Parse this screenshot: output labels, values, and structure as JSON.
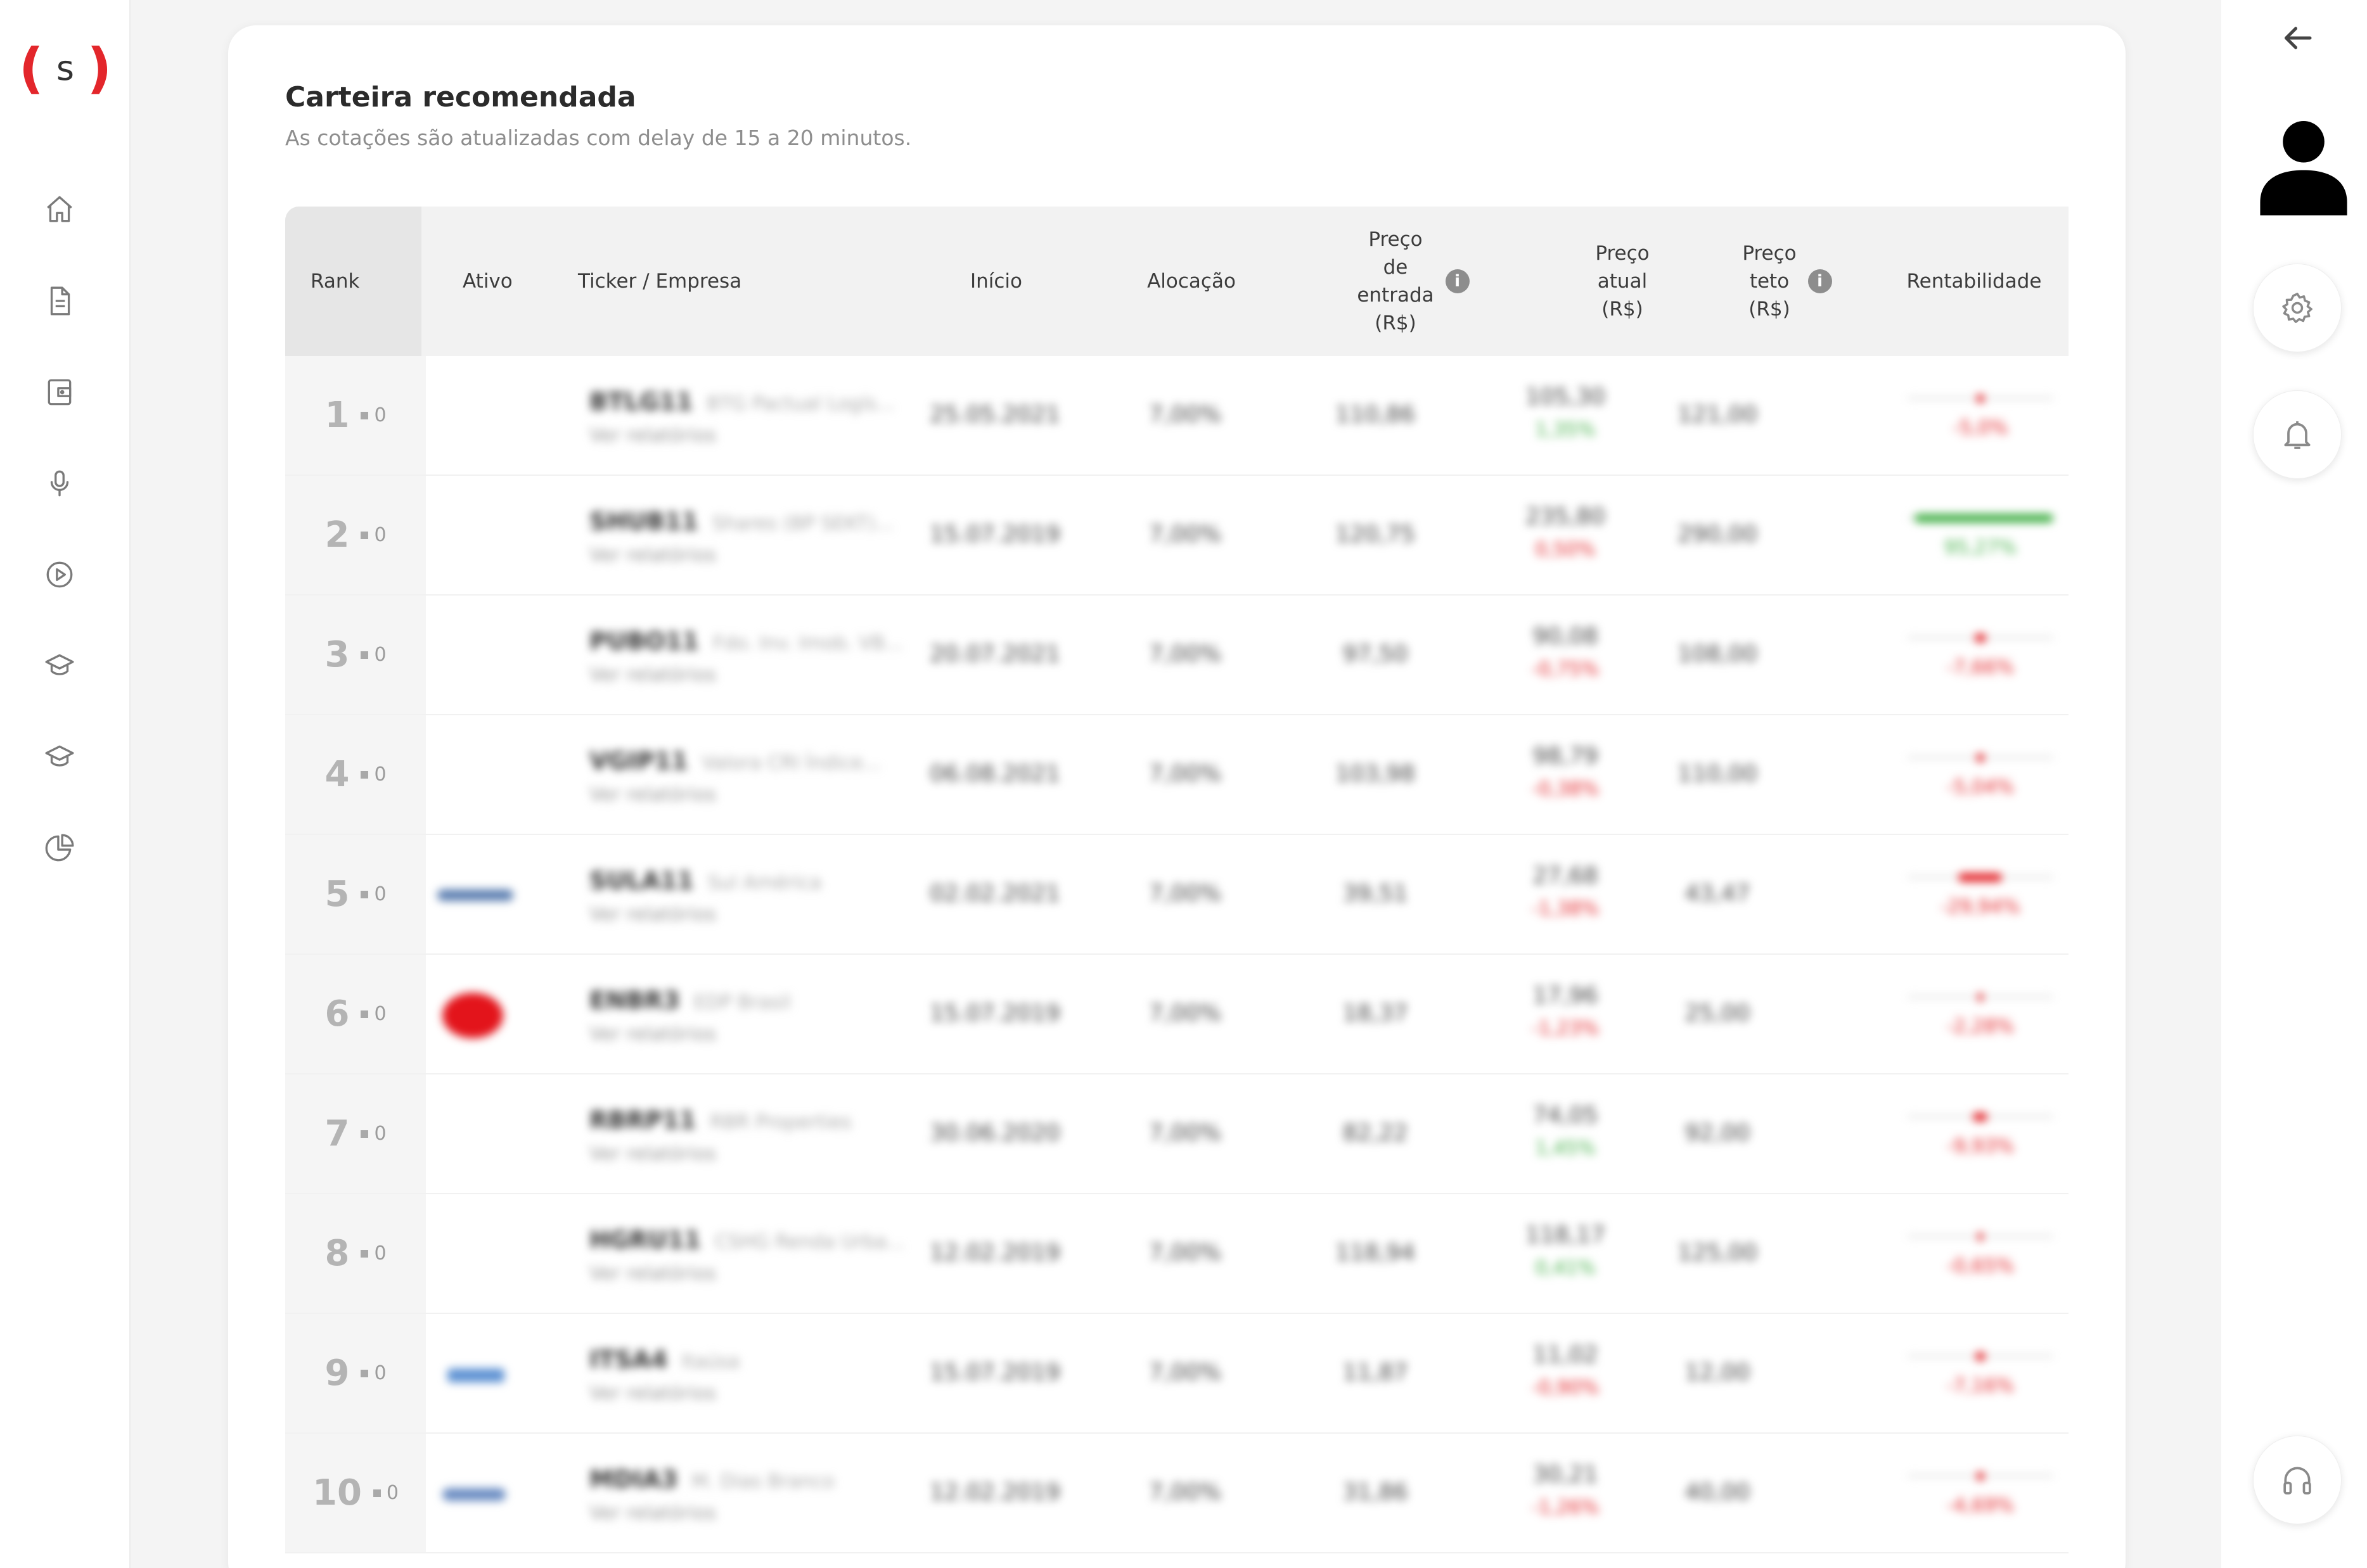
{
  "brand": {
    "logo_left": "(",
    "logo_letter": "s",
    "logo_right": ")",
    "accent_color": "#e3262b"
  },
  "left_nav": [
    {
      "name": "home-icon"
    },
    {
      "name": "document-icon"
    },
    {
      "name": "wallet-icon"
    },
    {
      "name": "microphone-icon"
    },
    {
      "name": "play-circle-icon"
    },
    {
      "name": "graduation-cap-icon"
    },
    {
      "name": "graduation-cap-icon-2"
    },
    {
      "name": "pie-chart-icon"
    }
  ],
  "right_panel": {
    "icons": [
      "back-arrow-icon",
      "user-avatar-icon",
      "gear-icon",
      "bell-icon",
      "headphones-icon"
    ]
  },
  "page": {
    "title": "Carteira recomendada",
    "subtitle": "As cotações são atualizadas com delay de 15 a 20 minutos."
  },
  "table": {
    "headers": {
      "rank": "Rank",
      "ativo": "Ativo",
      "ticker": "Ticker / Empresa",
      "inicio": "Início",
      "alocacao": "Alocação",
      "preco_entrada_1": "Preço",
      "preco_entrada_2": "de",
      "preco_entrada_3": "entrada",
      "preco_entrada_4": "(R$)",
      "preco_atual_1": "Preço",
      "preco_atual_2": "atual",
      "preco_atual_3": "(R$)",
      "preco_teto_1": "Preço",
      "preco_teto_2": "teto",
      "preco_teto_3": "(R$)",
      "rentabilidade": "Rentabilidade",
      "info_glyph": "i"
    },
    "rows": [
      {
        "rank": "1",
        "change": "0",
        "ticker": "BTLG11",
        "company": "BTG Pactual Logís...",
        "sub": "Ver relatórios",
        "inicio": "25.05.2021",
        "alocacao": "7,00%",
        "entrada": "110,86",
        "atual": "105,30",
        "atual_pct": "1,35%",
        "atual_pos": true,
        "teto": "121,00",
        "rent": "-5,0%",
        "rent_pos": false,
        "rent_frac": 0.05,
        "logo": ""
      },
      {
        "rank": "2",
        "change": "0",
        "ticker": "SHUB11",
        "company": "Shares (BP SEKT)...",
        "sub": "Ver relatórios",
        "inicio": "15.07.2019",
        "alocacao": "7,00%",
        "entrada": "120,75",
        "atual": "235,80",
        "atual_pct": "0,50%",
        "atual_pos": false,
        "teto": "290,00",
        "rent": "95,27%",
        "rent_pos": true,
        "rent_frac": 0.95,
        "logo": ""
      },
      {
        "rank": "3",
        "change": "0",
        "ticker": "PUBO11",
        "company": "Fdo. Inv. Imob. VB...",
        "sub": "Ver relatórios",
        "inicio": "20.07.2021",
        "alocacao": "7,00%",
        "entrada": "97,50",
        "atual": "90,08",
        "atual_pct": "-0,75%",
        "atual_pos": false,
        "teto": "108,00",
        "rent": "-7,66%",
        "rent_pos": false,
        "rent_frac": 0.08,
        "logo": ""
      },
      {
        "rank": "4",
        "change": "0",
        "ticker": "VGIP11",
        "company": "Valora CRI Índice...",
        "sub": "Ver relatórios",
        "inicio": "06.08.2021",
        "alocacao": "7,00%",
        "entrada": "103,98",
        "atual": "98,79",
        "atual_pct": "-0,38%",
        "atual_pos": false,
        "teto": "110,00",
        "rent": "-5,04%",
        "rent_pos": false,
        "rent_frac": 0.05,
        "logo": ""
      },
      {
        "rank": "5",
        "change": "0",
        "ticker": "SULA11",
        "company": "Sul América",
        "sub": "Ver relatórios",
        "inicio": "02.02.2021",
        "alocacao": "7,00%",
        "entrada": "39,51",
        "atual": "27,68",
        "atual_pct": "-1,38%",
        "atual_pos": false,
        "teto": "43,47",
        "rent": "-29,94%",
        "rent_pos": false,
        "rent_frac": 0.3,
        "logo": "blue-wave"
      },
      {
        "rank": "6",
        "change": "0",
        "ticker": "ENBR3",
        "company": "EDP Brasil",
        "sub": "Ver relatórios",
        "inicio": "15.07.2019",
        "alocacao": "7,00%",
        "entrada": "18,37",
        "atual": "17,96",
        "atual_pct": "-1,23%",
        "atual_pos": false,
        "teto": "25,00",
        "rent": "-2,28%",
        "rent_pos": false,
        "rent_frac": 0.02,
        "logo": "red-circle"
      },
      {
        "rank": "7",
        "change": "0",
        "ticker": "RBRP11",
        "company": "RBR Properties",
        "sub": "Ver relatórios",
        "inicio": "30.06.2020",
        "alocacao": "7,00%",
        "entrada": "82,22",
        "atual": "74,05",
        "atual_pct": "1,45%",
        "atual_pos": true,
        "teto": "92,00",
        "rent": "-9,93%",
        "rent_pos": false,
        "rent_frac": 0.1,
        "logo": ""
      },
      {
        "rank": "8",
        "change": "0",
        "ticker": "HGRU11",
        "company": "CSHG Renda Urba...",
        "sub": "Ver relatórios",
        "inicio": "12.02.2019",
        "alocacao": "7,00%",
        "entrada": "118,94",
        "atual": "118,17",
        "atual_pct": "0,41%",
        "atual_pos": true,
        "teto": "125,00",
        "rent": "-0,65%",
        "rent_pos": false,
        "rent_frac": 0.01,
        "logo": ""
      },
      {
        "rank": "9",
        "change": "0",
        "ticker": "ITSA4",
        "company": "Itaúsa",
        "sub": "Ver relatórios",
        "inicio": "15.07.2019",
        "alocacao": "7,00%",
        "entrada": "11,87",
        "atual": "11,02",
        "atual_pct": "-0,90%",
        "atual_pos": false,
        "teto": "12,00",
        "rent": "-7,16%",
        "rent_pos": false,
        "rent_frac": 0.07,
        "logo": "blue-text"
      },
      {
        "rank": "10",
        "change": "0",
        "ticker": "MDIA3",
        "company": "M. Dias Branco",
        "sub": "Ver relatórios",
        "inicio": "12.02.2019",
        "alocacao": "7,00%",
        "entrada": "31,86",
        "atual": "30,21",
        "atual_pct": "-1,26%",
        "atual_pos": false,
        "teto": "40,00",
        "rent": "-4,69%",
        "rent_pos": false,
        "rent_frac": 0.05,
        "logo": "blue-script"
      }
    ]
  }
}
